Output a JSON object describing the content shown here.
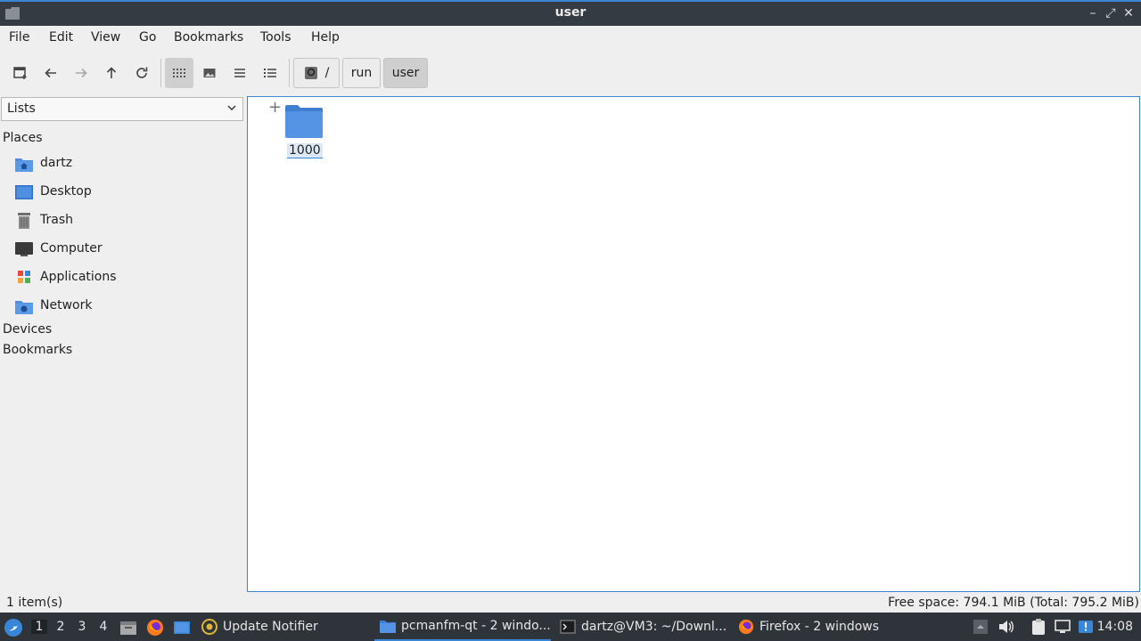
{
  "window": {
    "title": "user"
  },
  "menu": [
    "File",
    "Edit",
    "View",
    "Go",
    "Bookmarks",
    "Tools",
    "Help"
  ],
  "path": {
    "root": "/",
    "segments": [
      "run",
      "user"
    ]
  },
  "sidebar": {
    "selector": "Lists",
    "places_header": "Places",
    "places": [
      {
        "label": "dartz",
        "icon": "home-folder-icon"
      },
      {
        "label": "Desktop",
        "icon": "desktop-icon"
      },
      {
        "label": "Trash",
        "icon": "trash-icon"
      },
      {
        "label": "Computer",
        "icon": "computer-icon"
      },
      {
        "label": "Applications",
        "icon": "applications-icon"
      },
      {
        "label": "Network",
        "icon": "network-icon"
      }
    ],
    "devices_header": "Devices",
    "bookmarks_header": "Bookmarks"
  },
  "files": [
    {
      "name": "1000",
      "icon": "folder-icon"
    }
  ],
  "status": {
    "count": "1 item(s)",
    "space": "Free space: 794.1 MiB (Total: 795.2 MiB)"
  },
  "taskbar": {
    "desktops": [
      "1",
      "2",
      "3",
      "4"
    ],
    "tasks": [
      {
        "label": "Update Notifier"
      },
      {
        "label": "pcmanfm-qt - 2 windo..."
      },
      {
        "label": "dartz@VM3: ~/Downl..."
      },
      {
        "label": "Firefox - 2 windows"
      }
    ],
    "clock": "14:08"
  },
  "colors": {
    "accent": "#3a86d6",
    "folder": "#4f8fdf",
    "titlebar": "#353b43",
    "taskbar": "#2f343b"
  }
}
